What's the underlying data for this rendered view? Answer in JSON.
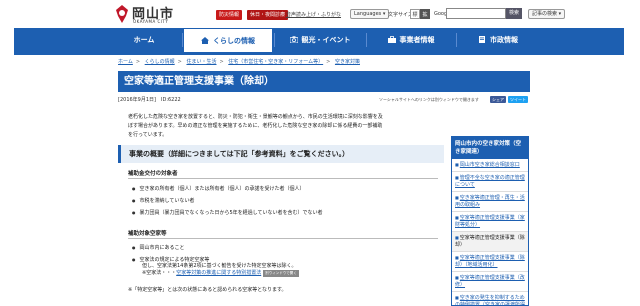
{
  "header": {
    "logo_title": "岡山市",
    "logo_sub": "OKAYAMA CITY",
    "disaster_label": "防災情報",
    "emergency_label": "休日・夜間診療",
    "readable_link": "音声読み上げ・ふりがな",
    "languages_label": "Languages",
    "fontsize_label": "文字サイズ",
    "fontsize_std": "標",
    "fontsize_large": "拡大",
    "search_engine": "Google",
    "search_placeholder": "",
    "search_button": "検索",
    "search_method": "記事の検索"
  },
  "nav": {
    "items": [
      {
        "label": "ホーム"
      },
      {
        "label": "くらしの情報"
      },
      {
        "label": "観光・イベント"
      },
      {
        "label": "事業者情報"
      },
      {
        "label": "市政情報"
      }
    ]
  },
  "breadcrumb": [
    "ホーム",
    "くらしの情報",
    "住まい・生活",
    "住宅（市営住宅・空き家・リフォーム等）",
    "空き家対策"
  ],
  "page": {
    "title": "空家等適正管理支援事業（除却）",
    "meta": "[2016年9月1日]　ID:6222",
    "social_note": "ソーシャルサイトへのリンクは別ウィンドウで開きます",
    "share_fb": "シェア",
    "share_tw": "ツイート",
    "intro_lines": [
      "老朽化した危険な空き家を放置すると、防災・防犯・衛生・景観等の観点から、市民の生活環境に深刻な影響を及",
      "ぼす場合があります。早めの適正な管理を実施するために、老朽化した危険な空き家の除却に係る経費の一部補助",
      "を行っています。"
    ],
    "summary_heading": "事業の概要（詳細につきましては下記「参考資料」をご覧ください。）",
    "target_heading": "補助金交付の対象者",
    "target_items": [
      "空き家の所有者（個人）または所有者（個人）の承諾を受けた者（個人）",
      "市税を滞納していない者",
      "暴力団員（暴力団員でなくなった日から5年を経過していない者を含む）でない者"
    ],
    "house_heading": "補助対象空家等",
    "house_items": [
      "岡山市内にあること",
      "空家法の規定による特定空家等"
    ],
    "house_note_1": "但し、空家法第14条第2項に基づく勧告を受けた特定空家等は除く。",
    "house_note_2_prefix": "※空家法・・・",
    "house_note_link": "空家等対策の推進に関する特別措置法",
    "house_note_newwin": "別ウィンドウで開く",
    "footnote": "※「特定空家等」とは次の状態にあると認められる空家等となります。"
  },
  "side": {
    "heading": "岡山市内の空き家対策（空き家関連）",
    "items": [
      {
        "label": "岡山市空き家総合相談窓口",
        "current": false
      },
      {
        "label": "管理不全な空き家の適正管理について",
        "current": false
      },
      {
        "label": "空き家等適正管理・再生・活用の取組み",
        "current": false
      },
      {
        "label": "空家等適正管理支援事業（家財等処分）",
        "current": false
      },
      {
        "label": "空家等適正管理支援事業（除却）",
        "current": true
      },
      {
        "label": "空家等適正管理支援事業（除却）（地域活用化）",
        "current": false
      },
      {
        "label": "空家等適正管理支援事業（改修）",
        "current": false
      },
      {
        "label": "空き家の発生を抑制するための特例措置（空き家の譲渡所得の3,000万円特別控除）",
        "current": false
      }
    ]
  },
  "colors": {
    "brand_blue": "#1d5fb1",
    "disaster_red": "#c81a1a"
  }
}
